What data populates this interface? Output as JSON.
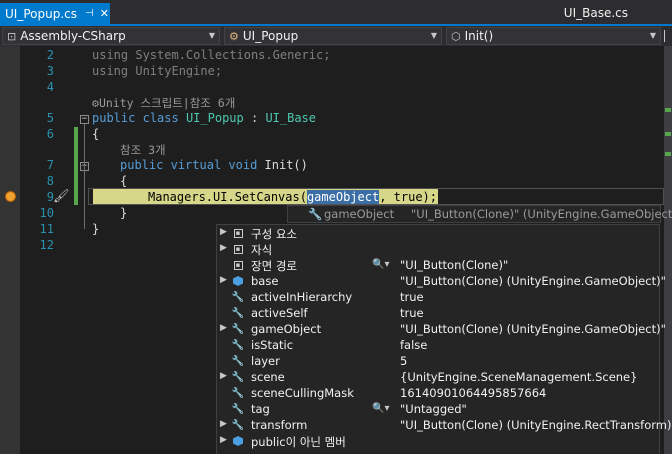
{
  "tabs": {
    "active": "UI_Popup.cs",
    "active_pin_icon": "pin-icon",
    "active_close": "✕",
    "other": "UI_Base.cs"
  },
  "nav": {
    "project": "Assembly-CSharp",
    "class": "UI_Popup",
    "member": "Init()"
  },
  "code": {
    "lines": [
      {
        "n": "2",
        "text": "using System.Collections.Generic;"
      },
      {
        "n": "3",
        "text": "using UnityEngine;"
      },
      {
        "n": "4",
        "text": ""
      },
      {
        "codelens_class": "Unity 스크립트|참조 6개"
      },
      {
        "n": "5",
        "text": "public class UI_Popup : UI_Base"
      },
      {
        "n": "6",
        "text": "{"
      },
      {
        "codelens_method": "참조 3개"
      },
      {
        "n": "7",
        "text": "public virtual void Init()"
      },
      {
        "n": "8",
        "text": "{"
      },
      {
        "n": "9",
        "text": "Managers.UI.SetCanvas(gameObject, true);"
      },
      {
        "n": "10",
        "text": "}"
      },
      {
        "n": "11",
        "text": "}"
      },
      {
        "n": "12",
        "text": ""
      }
    ],
    "breakpoint_color": "#f0a030",
    "highlight_color": "#d7d78a"
  },
  "datatip": {
    "header_name": "gameObject",
    "header_value": "\"UI_Button(Clone)\" (UnityEngine.GameObject)\"",
    "rows": [
      {
        "name": "구성 요소",
        "value": "",
        "icon": "component-box-icon"
      },
      {
        "name": "자식",
        "value": "",
        "icon": "children-box-icon"
      },
      {
        "name": "장면 경로",
        "value": "\"UI_Button(Clone)\"",
        "icon": "",
        "magnifier": true
      },
      {
        "name": "base",
        "value": "\"UI_Button(Clone) (UnityEngine.GameObject)\"",
        "icon": "base-cube-icon"
      },
      {
        "name": "activeInHierarchy",
        "value": "true",
        "icon": "wrench-icon"
      },
      {
        "name": "activeSelf",
        "value": "true",
        "icon": "wrench-icon"
      },
      {
        "name": "gameObject",
        "value": "\"UI_Button(Clone) (UnityEngine.GameObject)\"",
        "icon": "wrench-icon"
      },
      {
        "name": "isStatic",
        "value": "false",
        "icon": "wrench-icon"
      },
      {
        "name": "layer",
        "value": "5",
        "icon": "wrench-icon"
      },
      {
        "name": "scene",
        "value": "{UnityEngine.SceneManagement.Scene}",
        "icon": "wrench-icon"
      },
      {
        "name": "sceneCullingMask",
        "value": "16140901064495857664",
        "icon": "wrench-icon"
      },
      {
        "name": "tag",
        "value": "\"Untagged\"",
        "icon": "wrench-icon",
        "magnifier": true
      },
      {
        "name": "transform",
        "value": "\"UI_Button(Clone) (UnityEngine.RectTransform)\"",
        "icon": "wrench-icon"
      },
      {
        "name": "public이 아닌 멤버",
        "value": "",
        "icon": "nonpublic-cube-icon"
      }
    ]
  }
}
